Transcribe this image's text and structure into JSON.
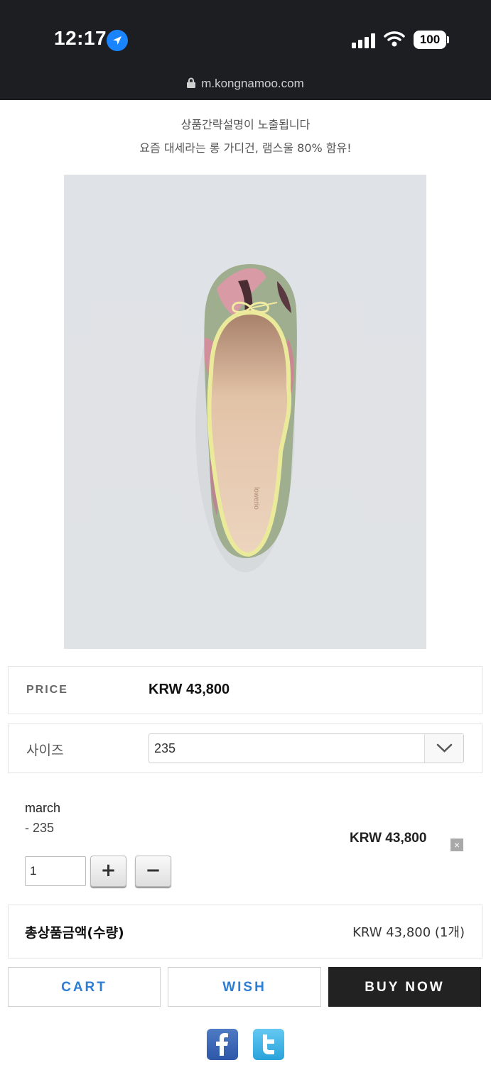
{
  "status_bar": {
    "time": "12:17",
    "battery": "100"
  },
  "browser": {
    "url": "m.kongnamoo.com"
  },
  "product": {
    "summary": "상품간략설명이 노출됩니다",
    "description": "요즘 대세라는 롱 가디건, 램스울 80% 함유!",
    "image_alt": "ballet flat shoe"
  },
  "price": {
    "label": "PRICE",
    "value": "KRW 43,800"
  },
  "option": {
    "label": "사이즈",
    "selected": "235"
  },
  "selected_item": {
    "name": "march",
    "option": "- 235",
    "quantity": "1",
    "price": "KRW 43,800",
    "plus": "+",
    "minus": "−",
    "remove": "×"
  },
  "total": {
    "label": "총상품금액(수량)",
    "value": "KRW 43,800 (1개)"
  },
  "actions": {
    "cart": "CART",
    "wish": "WISH",
    "buy_now": "BUY NOW"
  },
  "colors": {
    "buy_bg": "#222222",
    "link_blue": "#2b7dd6",
    "status_bg": "#1c1e21"
  },
  "icons": [
    "location-arrow-icon",
    "signal-icon",
    "wifi-icon",
    "battery-icon",
    "lock-icon",
    "chevron-down-icon",
    "facebook-icon",
    "twitter-icon"
  ]
}
